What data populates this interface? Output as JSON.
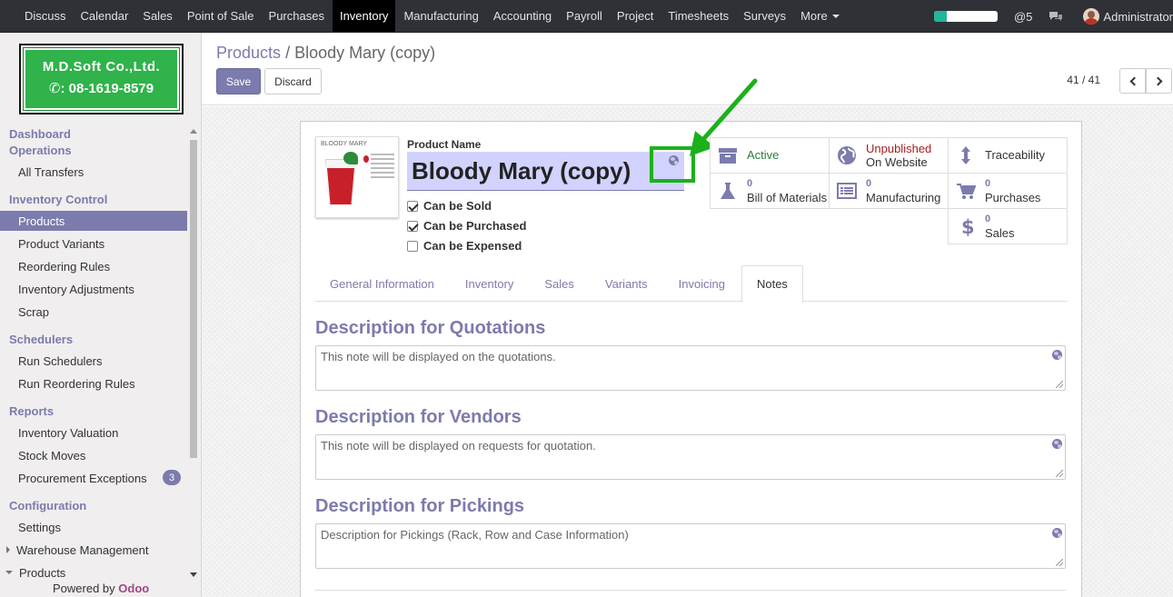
{
  "topbar": {
    "menu": [
      "Discuss",
      "Calendar",
      "Sales",
      "Point of Sale",
      "Purchases",
      "Inventory",
      "Manufacturing",
      "Accounting",
      "Payroll",
      "Project",
      "Timesheets",
      "Surveys"
    ],
    "more": "More",
    "at_count": "@5",
    "user": "Administrator",
    "progress_fraction": 0.2
  },
  "sidebar": {
    "logo_line1": "M.D.Soft Co.,Ltd.",
    "logo_line2": ": 08-1619-8579",
    "dashboard": "Dashboard",
    "operations": "Operations",
    "all_transfers": "All Transfers",
    "inventory_control": "Inventory Control",
    "products": "Products",
    "product_variants": "Product Variants",
    "reordering_rules": "Reordering Rules",
    "inventory_adjustments": "Inventory Adjustments",
    "scrap": "Scrap",
    "schedulers": "Schedulers",
    "run_schedulers": "Run Schedulers",
    "run_reordering": "Run Reordering Rules",
    "reports": "Reports",
    "inventory_valuation": "Inventory Valuation",
    "stock_moves": "Stock Moves",
    "procurement_exceptions": "Procurement Exceptions",
    "procurement_count": "3",
    "configuration": "Configuration",
    "settings": "Settings",
    "warehouse_management": "Warehouse Management",
    "products_config": "Products",
    "powered_by": "Powered by",
    "odoo": "Odoo"
  },
  "control_panel": {
    "breadcrumb_parent": "Products",
    "breadcrumb_sep": "/",
    "breadcrumb_current": "Bloody Mary (copy)",
    "save": "Save",
    "discard": "Discard",
    "pager": "41 / 41"
  },
  "product": {
    "image_caption": "BLOODY MARY",
    "name_label": "Product Name",
    "name": "Bloody Mary (copy)",
    "can_be_sold": "Can be Sold",
    "can_be_purchased": "Can be Purchased",
    "can_be_expensed": "Can be Expensed"
  },
  "smart_buttons": {
    "active": "Active",
    "unpublished": "Unpublished",
    "on_website": "On Website",
    "traceability": "Traceability",
    "bom_count": "0",
    "bom_label": "Bill of Materials",
    "mfg_count": "0",
    "mfg_label": "Manufacturing",
    "purchases_count": "0",
    "purchases_label": "Purchases",
    "sales_count": "0",
    "sales_label": "Sales"
  },
  "tabs": [
    "General Information",
    "Inventory",
    "Sales",
    "Variants",
    "Invoicing",
    "Notes"
  ],
  "notes": {
    "quotations_title": "Description for Quotations",
    "quotations_placeholder": "This note will be displayed on the quotations.",
    "vendors_title": "Description for Vendors",
    "vendors_placeholder": "This note will be displayed on requests for quotation.",
    "pickings_title": "Description for Pickings",
    "pickings_placeholder": "Description for Pickings (Rack, Row and Case Information)"
  },
  "colors": {
    "brand": "#7c7bad",
    "navbar": "#2f3136",
    "annotation": "#1bb11b",
    "active_green": "#28803b",
    "unpublished_red": "#a61c1c"
  }
}
